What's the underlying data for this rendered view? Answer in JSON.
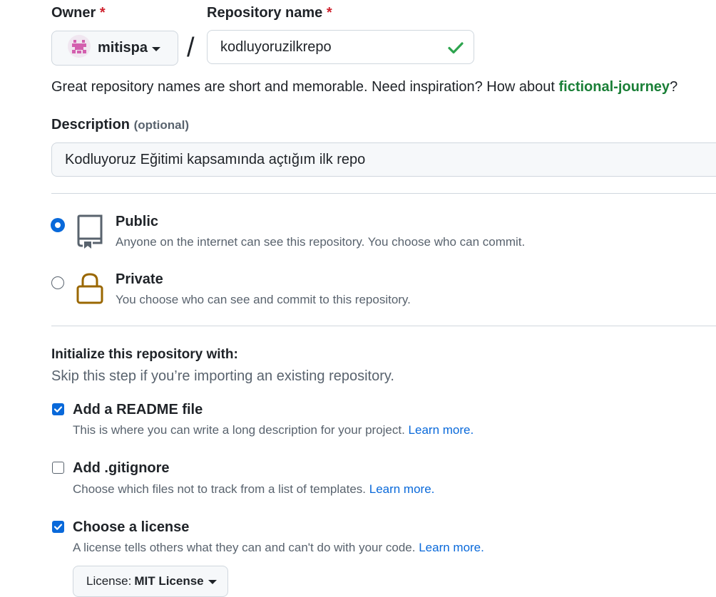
{
  "owner": {
    "label": "Owner",
    "required_mark": "*",
    "value": "mitispa"
  },
  "repo_name": {
    "label": "Repository name",
    "required_mark": "*",
    "value": "kodluyoruzilkrepo",
    "separator": "/"
  },
  "name_hint": {
    "text": "Great repository names are short and memorable. Need inspiration? How about ",
    "suggestion": "fictional-journey",
    "suffix": "?"
  },
  "description": {
    "label": "Description",
    "optional": "(optional)",
    "value": "Kodluyoruz Eğitimi kapsamında açtığım ilk repo"
  },
  "visibility": {
    "options": [
      {
        "title": "Public",
        "desc": "Anyone on the internet can see this repository. You choose who can commit.",
        "icon": "repo-icon",
        "selected": true
      },
      {
        "title": "Private",
        "desc": "You choose who can see and commit to this repository.",
        "icon": "lock-icon",
        "selected": false
      }
    ]
  },
  "init": {
    "title": "Initialize this repository with:",
    "subtitle": "Skip this step if you’re importing an existing repository.",
    "readme": {
      "title": "Add a README file",
      "desc": "This is where you can write a long description for your project. ",
      "link": "Learn more.",
      "checked": true
    },
    "gitignore": {
      "title": "Add .gitignore",
      "desc": "Choose which files not to track from a list of templates. ",
      "link": "Learn more.",
      "checked": false
    },
    "license": {
      "title": "Choose a license",
      "desc": "A license tells others what they can and can't do with your code. ",
      "link": "Learn more.",
      "checked": true
    },
    "license_select": {
      "prefix": "License: ",
      "value": "MIT License"
    }
  },
  "colors": {
    "accent": "#0969da",
    "success": "#2da44e",
    "required": "#cf222e",
    "suggestion": "#1a7f37",
    "lock": "#9a6700"
  }
}
